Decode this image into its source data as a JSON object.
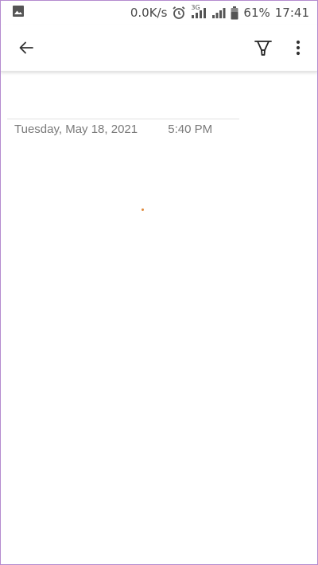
{
  "status_bar": {
    "speed": "0.0K/s",
    "network_type": "3G",
    "battery": "61%",
    "time": "17:41",
    "icons": [
      "gallery-icon",
      "alarm-icon",
      "signal-icon",
      "signal-icon",
      "battery-icon"
    ]
  },
  "toolbar": {
    "icons": [
      "back-arrow-icon",
      "highlighter-icon",
      "more-vert-icon"
    ]
  },
  "note": {
    "date": "Tuesday, May 18, 2021",
    "time": "5:40 PM"
  },
  "colors": {
    "frame_border": "#b48bcf",
    "cursor": "#e08a3c",
    "meta_text": "#7a7a7a"
  }
}
